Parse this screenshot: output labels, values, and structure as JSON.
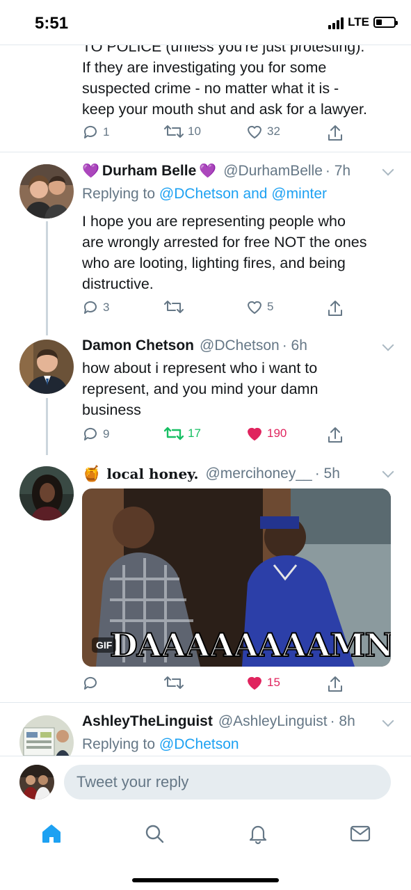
{
  "status_bar": {
    "time": "5:51",
    "network": "LTE",
    "battery_level": 0.35
  },
  "tweet0": {
    "text_line1": "TO POLICE (unless you're just protesting).",
    "text_line2": "If they are investigating you for some",
    "text_line3": "suspected crime - no matter what it is -",
    "text_line4": "keep your mouth shut and ask for a lawyer.",
    "replies": "1",
    "retweets": "10",
    "likes": "32"
  },
  "tweet1": {
    "emoji_left": "💜",
    "name": "Durham Belle",
    "emoji_right": "💜",
    "handle": "@DurhamBelle",
    "time": "· 7h",
    "replying_prefix": "Replying to",
    "mention1": "@DChetson",
    "and_word": "and",
    "mention2": "@minter",
    "text_line1": "I hope you are representing people who",
    "text_line2": "are wrongly arrested for free NOT the ones",
    "text_line3": "who are looting, lighting fires, and being",
    "text_line4": "distructive.",
    "replies": "3",
    "retweets": "",
    "likes": "5"
  },
  "tweet2": {
    "name": "Damon Chetson",
    "handle": "@DChetson",
    "time": "· 6h",
    "text_line1": "how about i represent who i want to",
    "text_line2": "represent, and you mind your damn",
    "text_line3": "business",
    "replies": "9",
    "retweets": "17",
    "likes": "190"
  },
  "tweet3": {
    "emoji": "🍯",
    "name": "local honey.",
    "handle": "@mercihoney__",
    "time": "· 5h",
    "gif_badge": "GIF",
    "gif_caption": "DAAAAAAAAMN",
    "replies": "",
    "retweets": "",
    "likes": "15"
  },
  "tweet4": {
    "name": "AshleyTheLinguist",
    "handle": "@AshleyLinguist",
    "time": "· 8h",
    "replying_prefix": "Replying to",
    "mention1": "@DChetson"
  },
  "reply_bar": {
    "placeholder": "Tweet your reply"
  },
  "tab_bar": {
    "icons": [
      "home-icon",
      "search-icon",
      "notifications-icon",
      "messages-icon"
    ],
    "active": "home-icon"
  },
  "colors": {
    "accent": "#1da1f2",
    "retweet_active": "#17bf63",
    "like_active": "#e0245e",
    "muted": "#657786"
  }
}
